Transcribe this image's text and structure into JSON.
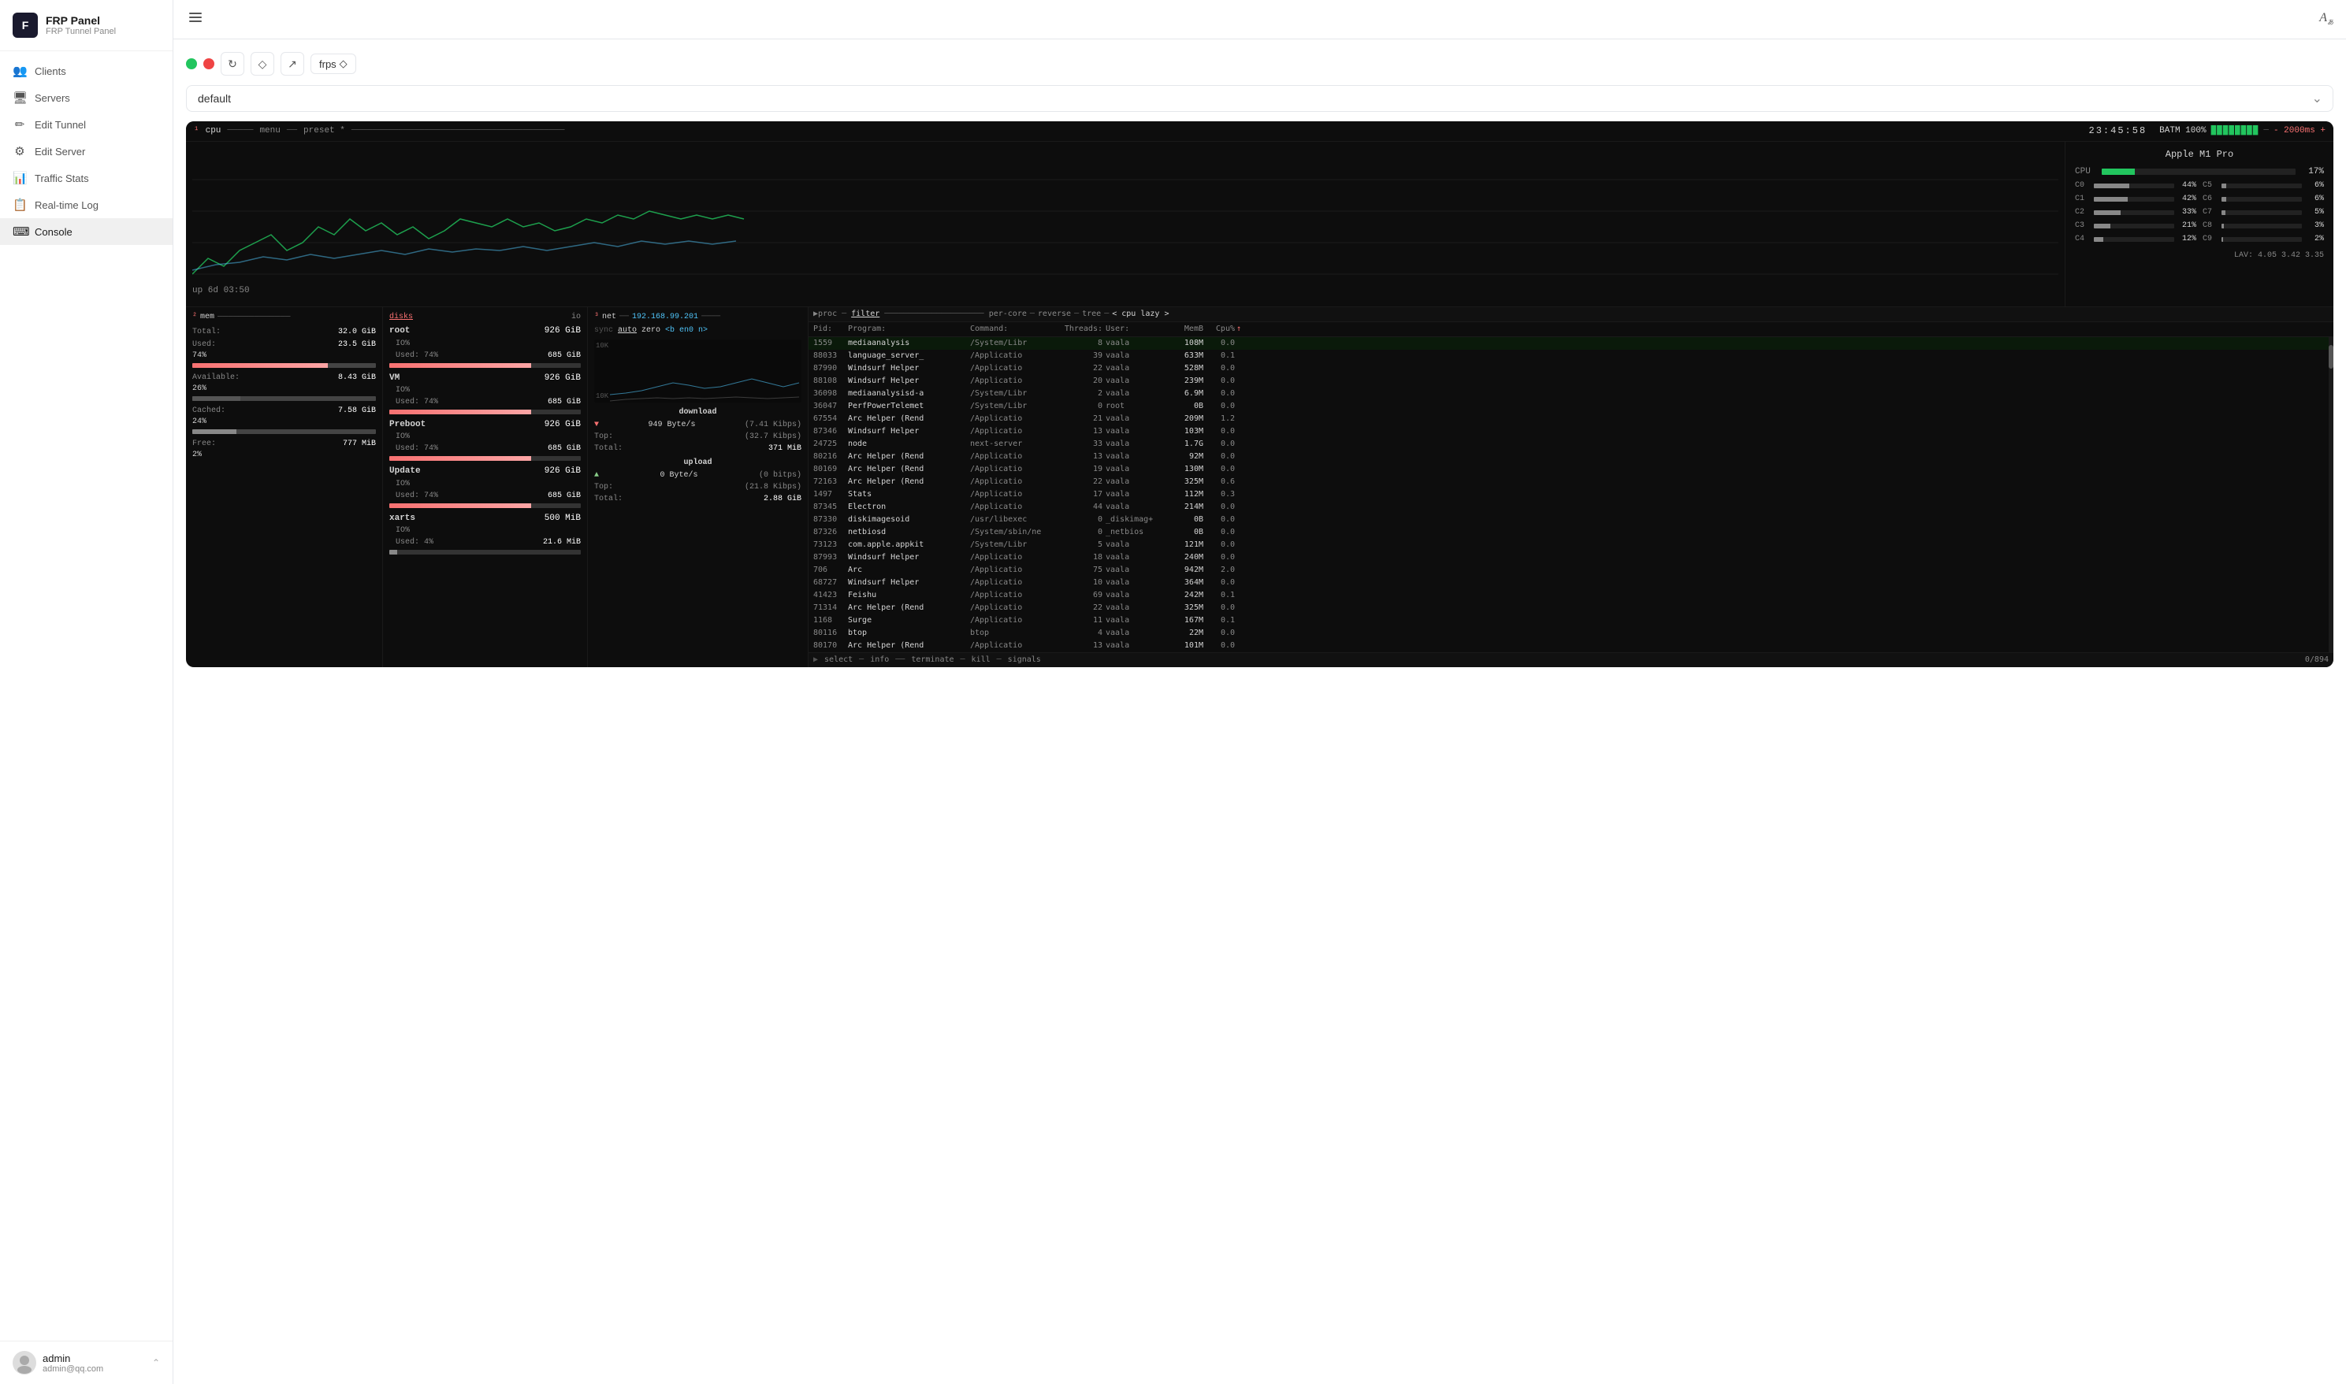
{
  "app": {
    "title": "FRP Panel",
    "subtitle": "FRP Tunnel Panel",
    "logo": "F"
  },
  "sidebar": {
    "items": [
      {
        "id": "clients",
        "label": "Clients",
        "icon": "👥"
      },
      {
        "id": "servers",
        "label": "Servers",
        "icon": "🖥"
      },
      {
        "id": "edit-tunnel",
        "label": "Edit Tunnel",
        "icon": "✏"
      },
      {
        "id": "edit-server",
        "label": "Edit Server",
        "icon": "⚙"
      },
      {
        "id": "traffic-stats",
        "label": "Traffic Stats",
        "icon": "📊"
      },
      {
        "id": "realtime-log",
        "label": "Real-time Log",
        "icon": "📋"
      },
      {
        "id": "console",
        "label": "Console",
        "icon": "⌨",
        "active": true
      }
    ]
  },
  "user": {
    "name": "admin",
    "email": "admin@qq.com"
  },
  "topbar": {
    "toggle_icon": "☰",
    "translate_icon": "A"
  },
  "controls": {
    "status_green": true,
    "status_red": true,
    "refresh_icon": "↻",
    "diamond_icon": "◇",
    "export_icon": "↗",
    "frps_label": "frps",
    "frps_arrow": "◇"
  },
  "server_select": {
    "value": "default",
    "placeholder": "default"
  },
  "terminal": {
    "tab1": "¹cpu",
    "tab_menu": "menu",
    "tab_preset": "preset *",
    "time": "23:45:58",
    "battery": "BATM 100%",
    "bat_blocks": "████████",
    "interval": "- 2000ms +",
    "uptime": "up 6d 03:50",
    "tab2": "²mem",
    "tab3": "³net",
    "net_iface": "192.168.99.201"
  },
  "cpu_info": {
    "model": "Apple M1 Pro",
    "overall_pct": "17%",
    "cores": [
      {
        "id": "CPU",
        "pct": 17,
        "label": "17%"
      },
      {
        "id": "C0",
        "pct": 44,
        "label": "44%"
      },
      {
        "id": "C1",
        "pct": 42,
        "label": "42%"
      },
      {
        "id": "C2",
        "pct": 33,
        "label": "33%"
      },
      {
        "id": "C3",
        "pct": 21,
        "label": "21%"
      },
      {
        "id": "C4",
        "pct": 12,
        "label": "12%"
      },
      {
        "id": "C5",
        "pct": 6,
        "label": "6%"
      },
      {
        "id": "C6",
        "pct": 6,
        "label": "6%"
      },
      {
        "id": "C7",
        "pct": 5,
        "label": "5%"
      },
      {
        "id": "C8",
        "pct": 3,
        "label": "3%"
      },
      {
        "id": "C9",
        "pct": 2,
        "label": "2%"
      }
    ],
    "lav": "LAV: 4.05  3.42  3.35"
  },
  "mem": {
    "total": "32.0 GiB",
    "used": "23.5 GiB",
    "used_pct": "74%",
    "available": "8.43 GiB",
    "available_pct": "26%",
    "cached": "7.58 GiB",
    "cached_pct": "24%",
    "free": "777 MiB",
    "free_pct": "2%"
  },
  "disks": [
    {
      "name": "root",
      "size": "926 GiB",
      "io": "IO%",
      "used_pct": "74%",
      "used": "685 GiB"
    },
    {
      "name": "VM",
      "size": "926 GiB",
      "io": "IO%",
      "used_pct": "74%",
      "used": "685 GiB"
    },
    {
      "name": "Preboot",
      "size": "926 GiB",
      "io": "IO%",
      "used_pct": "74%",
      "used": "685 GiB"
    },
    {
      "name": "Update",
      "size": "926 GiB",
      "io": "IO%",
      "used_pct": "74%",
      "used": "685 GiB"
    },
    {
      "name": "xarts",
      "size": "500 MiB",
      "io": "IO%",
      "used_pct": "4%",
      "used": "21.6 MiB"
    }
  ],
  "net": {
    "scale_top": "10K",
    "scale_bottom": "10K",
    "mode": "auto",
    "zero": "zero",
    "iface": "en0",
    "direction": "n",
    "download_label": "download",
    "dl_speed": "949 Byte/s",
    "dl_kibps": "(7.41 Kibps)",
    "dl_top": "(32.7 Kibps)",
    "dl_total": "371 MiB",
    "upload_label": "upload",
    "ul_speed": "0 Byte/s",
    "ul_bitps": "(0 bitps)",
    "ul_top": "(21.8 Kibps)",
    "ul_total": "2.88 GiB"
  },
  "proc": {
    "headers": [
      "Pid:",
      "Program:",
      "Command:",
      "Threads:",
      "User:",
      "MemB",
      "Cpu%"
    ],
    "filter": "filter",
    "per_core": "per-core",
    "reverse": "reverse",
    "tree": "tree",
    "sort": "< cpu lazy >",
    "count": "0/894",
    "rows": [
      {
        "pid": "1559",
        "prog": "mediaanalysis",
        "cmd": "/System/Libr",
        "thr": "8",
        "user": "vaala",
        "mem": "108M",
        "cpu": "0.0"
      },
      {
        "pid": "88033",
        "prog": "language_server_",
        "cmd": "/Applicatio",
        "thr": "39",
        "user": "vaala",
        "mem": "633M",
        "cpu": "0.1"
      },
      {
        "pid": "87990",
        "prog": "Windsurf Helper",
        "cmd": "/Applicatio",
        "thr": "22",
        "user": "vaala",
        "mem": "528M",
        "cpu": "0.0"
      },
      {
        "pid": "88108",
        "prog": "Windsurf Helper",
        "cmd": "/Applicatio",
        "thr": "20",
        "user": "vaala",
        "mem": "239M",
        "cpu": "0.0"
      },
      {
        "pid": "36098",
        "prog": "mediaanalysisd-a",
        "cmd": "/System/Libr",
        "thr": "2",
        "user": "vaala",
        "mem": "6.9M",
        "cpu": "0.0"
      },
      {
        "pid": "36047",
        "prog": "PerfPowerTelemet",
        "cmd": "/System/Libr",
        "thr": "0",
        "user": "root",
        "mem": "0B",
        "cpu": "0.0"
      },
      {
        "pid": "67554",
        "prog": "Arc Helper (Rend",
        "cmd": "/Applicatio",
        "thr": "21",
        "user": "vaala",
        "mem": "209M",
        "cpu": "1.2"
      },
      {
        "pid": "87346",
        "prog": "Windsurf Helper",
        "cmd": "/Applicatio",
        "thr": "13",
        "user": "vaala",
        "mem": "103M",
        "cpu": "0.0"
      },
      {
        "pid": "24725",
        "prog": "node",
        "cmd": "next-server",
        "thr": "33",
        "user": "vaala",
        "mem": "1.7G",
        "cpu": "0.0"
      },
      {
        "pid": "80216",
        "prog": "Arc Helper (Rend",
        "cmd": "/Applicatio",
        "thr": "13",
        "user": "vaala",
        "mem": "92M",
        "cpu": "0.0"
      },
      {
        "pid": "80169",
        "prog": "Arc Helper (Rend",
        "cmd": "/Applicatio",
        "thr": "19",
        "user": "vaala",
        "mem": "130M",
        "cpu": "0.0"
      },
      {
        "pid": "72163",
        "prog": "Arc Helper (Rend",
        "cmd": "/Applicatio",
        "thr": "22",
        "user": "vaala",
        "mem": "325M",
        "cpu": "0.6"
      },
      {
        "pid": "1497",
        "prog": "Stats",
        "cmd": "/Applicatio",
        "thr": "17",
        "user": "vaala",
        "mem": "112M",
        "cpu": "0.3"
      },
      {
        "pid": "87345",
        "prog": "Electron",
        "cmd": "/Applicatio",
        "thr": "44",
        "user": "vaala",
        "mem": "214M",
        "cpu": "0.0"
      },
      {
        "pid": "87330",
        "prog": "diskimagesoid",
        "cmd": "/usr/libexec",
        "thr": "0",
        "user": "_diskimag+",
        "mem": "0B",
        "cpu": "0.0"
      },
      {
        "pid": "87326",
        "prog": "netbiosd",
        "cmd": "/System/sbin/ne",
        "thr": "0",
        "user": "_netbios",
        "mem": "0B",
        "cpu": "0.0"
      },
      {
        "pid": "73123",
        "prog": "com.apple.appkit",
        "cmd": "/System/Libr",
        "thr": "5",
        "user": "vaala",
        "mem": "121M",
        "cpu": "0.0"
      },
      {
        "pid": "87993",
        "prog": "Windsurf Helper",
        "cmd": "/Applicatio",
        "thr": "18",
        "user": "vaala",
        "mem": "240M",
        "cpu": "0.0"
      },
      {
        "pid": "706",
        "prog": "Arc",
        "cmd": "/Applicatio",
        "thr": "75",
        "user": "vaala",
        "mem": "942M",
        "cpu": "2.0"
      },
      {
        "pid": "68727",
        "prog": "Windsurf Helper",
        "cmd": "/Applicatio",
        "thr": "10",
        "user": "vaala",
        "mem": "364M",
        "cpu": "0.0"
      },
      {
        "pid": "41423",
        "prog": "Feishu",
        "cmd": "/Applicatio",
        "thr": "69",
        "user": "vaala",
        "mem": "242M",
        "cpu": "0.1"
      },
      {
        "pid": "71314",
        "prog": "Arc Helper (Rend",
        "cmd": "/Applicatio",
        "thr": "22",
        "user": "vaala",
        "mem": "325M",
        "cpu": "0.0"
      },
      {
        "pid": "1168",
        "prog": "Surge",
        "cmd": "/Applicatio",
        "thr": "11",
        "user": "vaala",
        "mem": "167M",
        "cpu": "0.1"
      },
      {
        "pid": "80116",
        "prog": "btop",
        "cmd": "btop",
        "thr": "4",
        "user": "vaala",
        "mem": "22M",
        "cpu": "0.0"
      },
      {
        "pid": "80170",
        "prog": "Arc Helper (Rend",
        "cmd": "/Applicatio",
        "thr": "13",
        "user": "vaala",
        "mem": "101M",
        "cpu": "0.0"
      }
    ],
    "footer_items": [
      "select",
      "info",
      "terminate",
      "kill",
      "signals"
    ]
  }
}
